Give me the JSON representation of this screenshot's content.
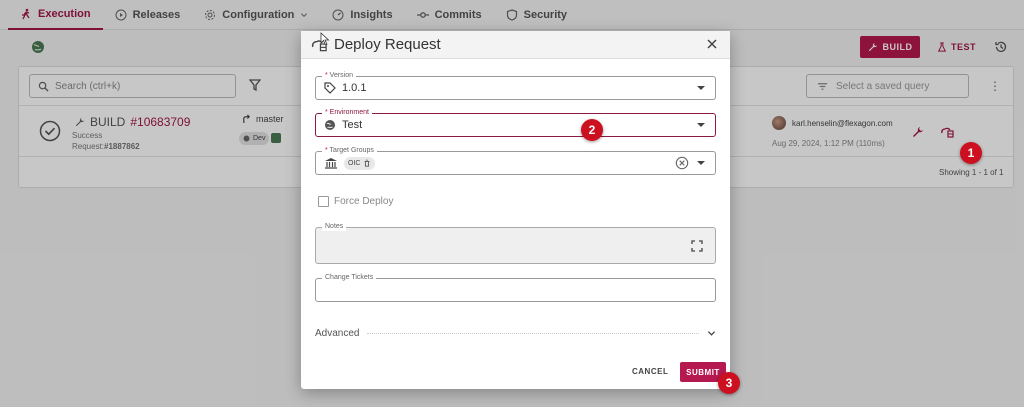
{
  "nav": {
    "tabs": [
      {
        "label": "Execution",
        "icon": "runner-icon",
        "active": true
      },
      {
        "label": "Releases",
        "icon": "play-circle-icon"
      },
      {
        "label": "Configuration",
        "icon": "gear-icon"
      },
      {
        "label": "Insights",
        "icon": "gauge-icon"
      },
      {
        "label": "Commits",
        "icon": "commit-icon"
      },
      {
        "label": "Security",
        "icon": "shield-icon"
      }
    ]
  },
  "toolbar": {
    "build_label": "BUILD",
    "test_label": "TEST"
  },
  "panel": {
    "search_placeholder": "Search (ctrl+k)",
    "saved_query_placeholder": "Select a saved query",
    "row": {
      "build_label": "BUILD",
      "build_number": "#10683709",
      "status": "Success",
      "request_prefix": "Request:",
      "request_number": "#1887862",
      "branch": "master",
      "env_chip": "Dev",
      "user_email": "karl.henselin@flexagon.com",
      "date": "Aug 29, 2024, 1:12 PM (110ms)"
    },
    "showing": "Showing 1 - 1 of 1"
  },
  "dialog": {
    "title": "Deploy Request",
    "version": {
      "label": "Version",
      "value": "1.0.1"
    },
    "environment": {
      "label": "Environment",
      "value": "Test"
    },
    "target_groups": {
      "label": "Target Groups",
      "chip": "OIC"
    },
    "force_deploy_label": "Force Deploy",
    "notes_label": "Notes",
    "change_tickets_label": "Change Tickets",
    "advanced_label": "Advanced",
    "cancel_label": "CANCEL",
    "submit_label": "SUBMIT"
  },
  "markers": [
    "1",
    "2",
    "3"
  ],
  "colors": {
    "accent": "#b5194f",
    "marker": "#cc1020"
  }
}
